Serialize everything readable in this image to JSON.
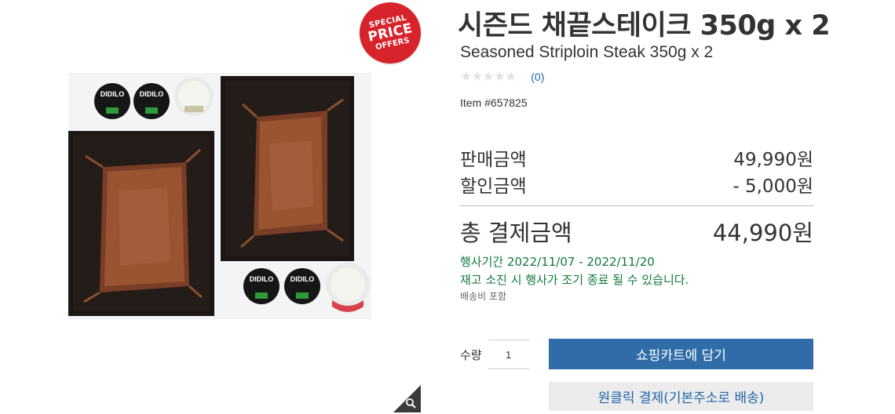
{
  "badge": {
    "line1": "SPECIAL",
    "line2": "PRICE",
    "line3": "OFFERS",
    "color": "#d7232b"
  },
  "product": {
    "title_ko": "시즌드 채끝스테이크 350g x 2",
    "title_en": "Seasoned Striploin Steak 350g x 2",
    "rating_stars": 0,
    "review_count": "(0)",
    "item_number": "Item #657825",
    "image_label": "DIDILO"
  },
  "price": {
    "sale_label": "판매금액",
    "sale_value": "49,990원",
    "discount_label": "할인금액",
    "discount_value": "- 5,000원",
    "total_label": "총 결제금액",
    "total_value": "44,990원"
  },
  "promo": {
    "period": "행사기간 2022/11/07 - 2022/11/20",
    "note": "재고 소진 시 행사가 조기 종료 될 수 있습니다.",
    "shipping": "배송비 포함",
    "color": "#127a3c"
  },
  "purchase": {
    "qty_label": "수량",
    "qty_value": "1",
    "cart_button": "쇼핑카트에 담기",
    "oneclick_button": "원클릭 결제(기본주소로 배송)",
    "cart_color": "#306da8"
  },
  "icons": {
    "zoom": "magnifier-icon",
    "star": "star-icon"
  }
}
